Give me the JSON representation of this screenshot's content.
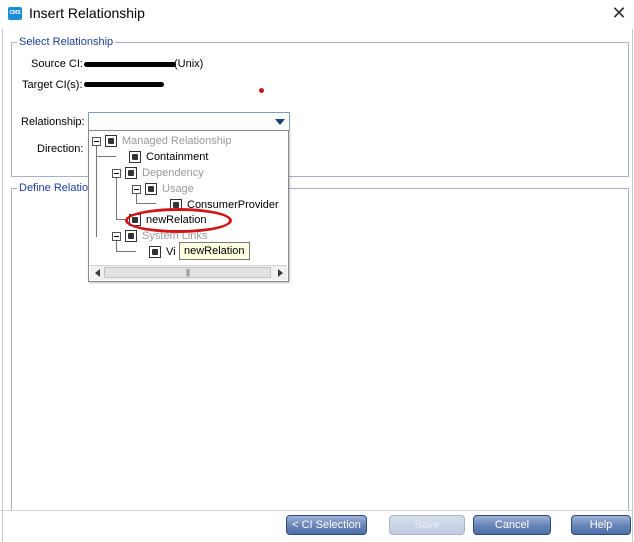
{
  "window": {
    "title": "Insert Relationship",
    "icon_text": "CMS"
  },
  "select_group": {
    "legend": "Select Relationship",
    "source_label": "Source CI:",
    "source_suffix": "(Unix)",
    "target_label": "Target CI(s):",
    "relationship_label": "Relationship:",
    "direction_label": "Direction:"
  },
  "define_group": {
    "legend": "Define Relationship"
  },
  "tree": {
    "root": "Managed Relationship",
    "containment": "Containment",
    "dependency": "Dependency",
    "usage": "Usage",
    "consumer_provider": "ConsumerProvider",
    "new_relation": "newRelation",
    "system_links": "System Links",
    "vi": "Vi"
  },
  "tooltip": "newRelation",
  "buttons": {
    "ci_selection": "< CI Selection",
    "save": "Save",
    "cancel": "Cancel",
    "help": "Help"
  },
  "colors": {
    "legend_text": "#1f3f9a",
    "annotation_red": "#d01616",
    "button_fill": "#6683b7"
  }
}
